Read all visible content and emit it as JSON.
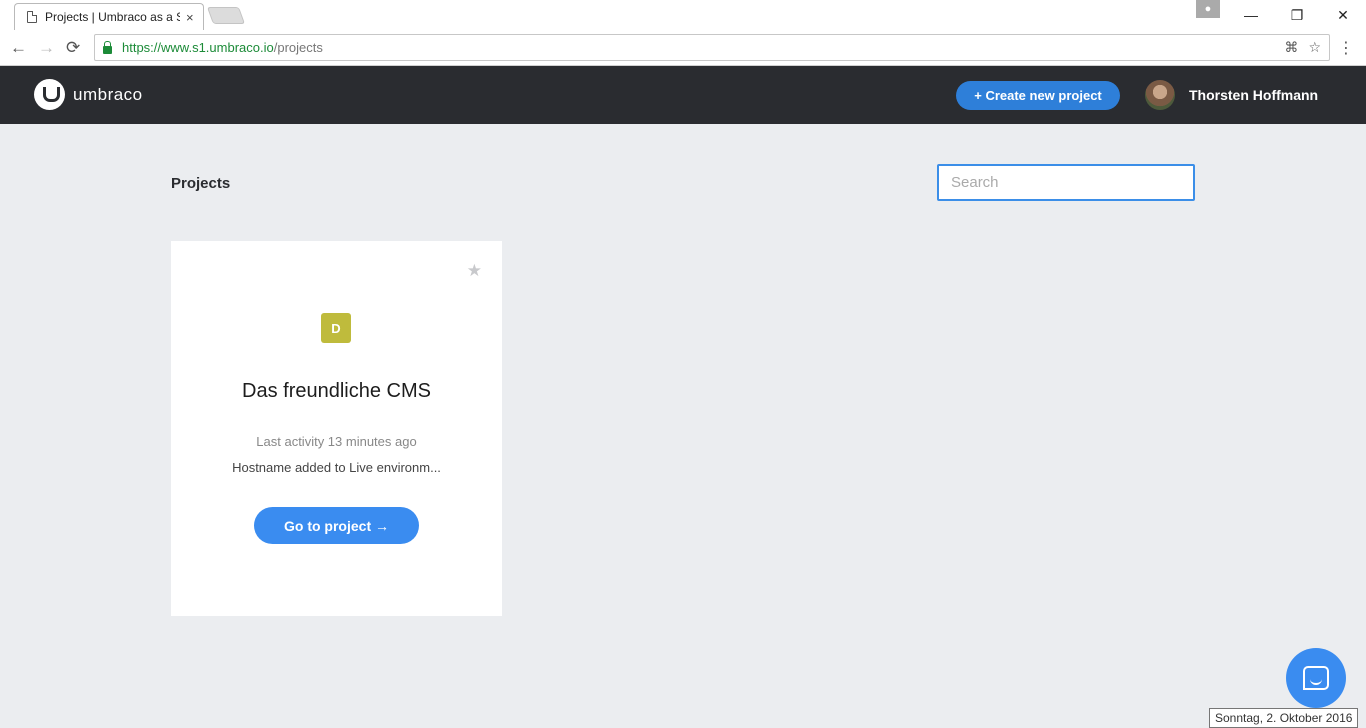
{
  "browser": {
    "tab_title": "Projects | Umbraco as a S",
    "tab_close": "×",
    "url_host": "https://www.s1.umbraco.io",
    "url_path": "/projects",
    "minimize": "—",
    "restore": "❐",
    "close": "✕",
    "back": "←",
    "forward": "→",
    "reload": "⟳"
  },
  "header": {
    "logo_text": "umbraco",
    "create_button": "+ Create new project",
    "user_name": "Thorsten Hoffmann"
  },
  "main": {
    "title": "Projects",
    "search_placeholder": "Search"
  },
  "projects": [
    {
      "badge": "D",
      "name": "Das freundliche CMS",
      "activity": "Last activity 13 minutes ago",
      "event": "Hostname added to Live environm...",
      "button": "Go to project →",
      "badge_color": "#bfbb3c"
    }
  ],
  "tooltip": {
    "date": "Sonntag, 2. Oktober 2016"
  },
  "colors": {
    "accent": "#3a8cf0",
    "header_bg": "#2a2c30",
    "page_bg": "#ebedf0"
  }
}
